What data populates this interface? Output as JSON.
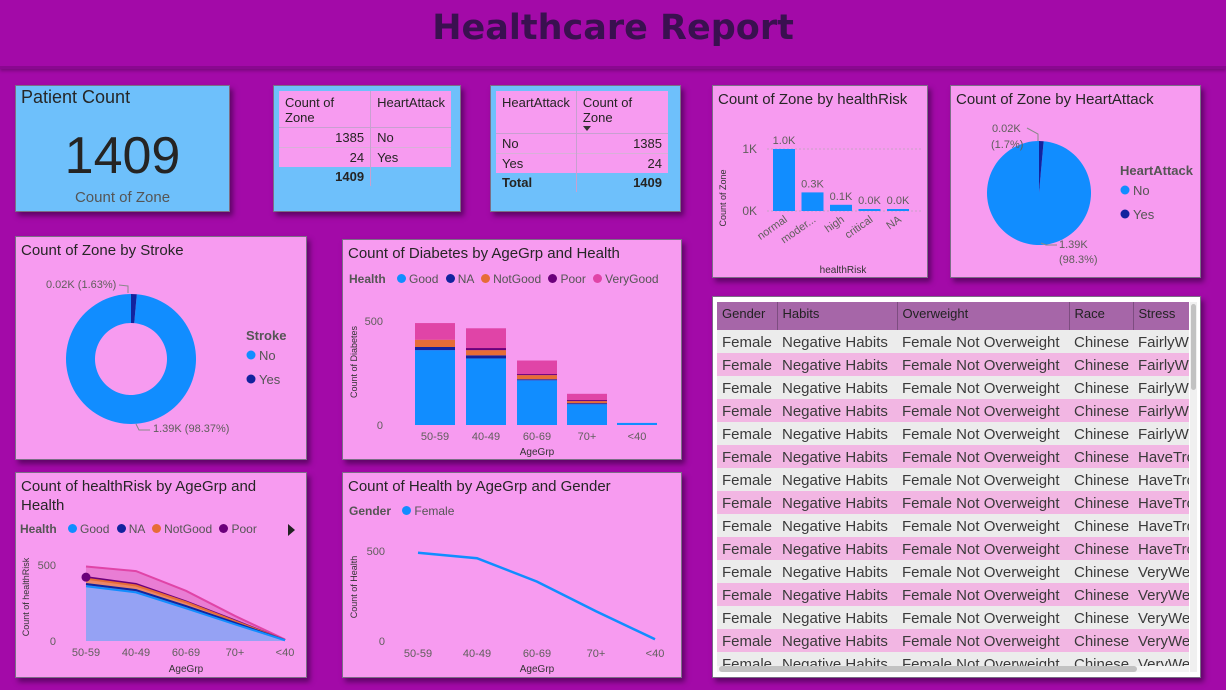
{
  "report_title": "Healthcare Report",
  "kpi": {
    "title": "Patient Count",
    "value": "1409",
    "label": "Count of Zone"
  },
  "matrix1": {
    "headers": [
      "Count of Zone",
      "HeartAttack"
    ],
    "rows": [
      [
        "1385",
        "No"
      ],
      [
        "24",
        "Yes"
      ]
    ],
    "total": "1409"
  },
  "matrix2": {
    "headers": [
      "HeartAttack",
      "Count of Zone"
    ],
    "rows": [
      [
        "No",
        "1385"
      ],
      [
        "Yes",
        "24"
      ]
    ],
    "total_label": "Total",
    "total": "1409"
  },
  "colors": {
    "good": "#118dff",
    "na": "#12239e",
    "notgood": "#e66c37",
    "poor": "#6b007b",
    "verygood": "#e044a7",
    "card_pink": "#f79bf0",
    "card_blue": "#6ec0fb",
    "background": "#a30aa8"
  },
  "icons": {
    "visual_more": "play-triangle-icon"
  },
  "data_table": {
    "columns": [
      "Gender",
      "Habits",
      "Overweight",
      "Race",
      "Stress"
    ],
    "rows": [
      [
        "Female",
        "Negative Habits",
        "Female Not Overweight",
        "Chinese",
        "FairlyW"
      ],
      [
        "Female",
        "Negative Habits",
        "Female Not Overweight",
        "Chinese",
        "FairlyW"
      ],
      [
        "Female",
        "Negative Habits",
        "Female Not Overweight",
        "Chinese",
        "FairlyW"
      ],
      [
        "Female",
        "Negative Habits",
        "Female Not Overweight",
        "Chinese",
        "FairlyW"
      ],
      [
        "Female",
        "Negative Habits",
        "Female Not Overweight",
        "Chinese",
        "FairlyW"
      ],
      [
        "Female",
        "Negative Habits",
        "Female Not Overweight",
        "Chinese",
        "HaveTro"
      ],
      [
        "Female",
        "Negative Habits",
        "Female Not Overweight",
        "Chinese",
        "HaveTro"
      ],
      [
        "Female",
        "Negative Habits",
        "Female Not Overweight",
        "Chinese",
        "HaveTro"
      ],
      [
        "Female",
        "Negative Habits",
        "Female Not Overweight",
        "Chinese",
        "HaveTro"
      ],
      [
        "Female",
        "Negative Habits",
        "Female Not Overweight",
        "Chinese",
        "HaveTro"
      ],
      [
        "Female",
        "Negative Habits",
        "Female Not Overweight",
        "Chinese",
        "VeryWe"
      ],
      [
        "Female",
        "Negative Habits",
        "Female Not Overweight",
        "Chinese",
        "VeryWe"
      ],
      [
        "Female",
        "Negative Habits",
        "Female Not Overweight",
        "Chinese",
        "VeryWe"
      ],
      [
        "Female",
        "Negative Habits",
        "Female Not Overweight",
        "Chinese",
        "VeryWe"
      ],
      [
        "Female",
        "Negative Habits",
        "Female Not Overweight",
        "Chinese",
        "VeryWe"
      ]
    ]
  },
  "chart_data": [
    {
      "id": "zone_by_healthrisk",
      "type": "bar",
      "title": "Count of Zone by healthRisk",
      "xlabel": "healthRisk",
      "ylabel": "Count of Zone",
      "categories": [
        "normal",
        "moder...",
        "high",
        "critical",
        "NA"
      ],
      "values": [
        1000,
        300,
        100,
        0,
        0
      ],
      "data_labels": [
        "1.0K",
        "0.3K",
        "0.1K",
        "0.0K",
        "0.0K"
      ],
      "yticks": [
        "0K",
        "1K"
      ],
      "ylim": [
        0,
        1000
      ],
      "grid": true
    },
    {
      "id": "zone_by_heartattack",
      "type": "pie",
      "title": "Count of Zone by HeartAttack",
      "legend_title": "HeartAttack",
      "categories": [
        "No",
        "Yes"
      ],
      "values": [
        1390,
        20
      ],
      "labels": [
        "1.39K",
        "0.02K"
      ],
      "percents": [
        "(98.3%)",
        "(1.7%)"
      ],
      "legend": "right"
    },
    {
      "id": "zone_by_stroke",
      "type": "pie",
      "donut": true,
      "title": "Count of Zone by Stroke",
      "legend_title": "Stroke",
      "categories": [
        "No",
        "Yes"
      ],
      "values": [
        1390,
        20
      ],
      "labels": [
        "1.39K (98.37%)",
        "0.02K (1.63%)"
      ],
      "legend": "right"
    },
    {
      "id": "diabetes_by_agegrp_health",
      "type": "bar",
      "stacked": true,
      "title": "Count of Diabetes by AgeGrp and Health",
      "legend_title": "Health",
      "xlabel": "AgeGrp",
      "ylabel": "Count of Diabetes",
      "categories": [
        "50-59",
        "40-49",
        "60-69",
        "70+",
        "<40"
      ],
      "series": [
        {
          "name": "Good",
          "values": [
            360,
            320,
            215,
            100,
            10
          ]
        },
        {
          "name": "NA",
          "values": [
            15,
            15,
            5,
            5,
            0
          ]
        },
        {
          "name": "NotGood",
          "values": [
            35,
            25,
            20,
            10,
            0
          ]
        },
        {
          "name": "Poor",
          "values": [
            0,
            10,
            5,
            5,
            0
          ]
        },
        {
          "name": "VeryGood",
          "values": [
            80,
            95,
            65,
            30,
            0
          ]
        }
      ],
      "yticks": [
        0,
        500
      ],
      "ylim": [
        0,
        500
      ],
      "legend": "top"
    },
    {
      "id": "healthrisk_by_agegrp_health",
      "type": "area",
      "title": "Count of healthRisk by AgeGrp and Health",
      "legend_title": "Health",
      "xlabel": "AgeGrp",
      "ylabel": "Count of healthRisk",
      "categories": [
        "50-59",
        "40-49",
        "60-69",
        "70+",
        "<40"
      ],
      "series": [
        {
          "name": "Good",
          "values": [
            360,
            320,
            215,
            110,
            5
          ]
        },
        {
          "name": "NA",
          "values": [
            375,
            335,
            230,
            120,
            5
          ]
        },
        {
          "name": "NotGood",
          "values": [
            410,
            365,
            255,
            130,
            5
          ]
        },
        {
          "name": "Poor",
          "values": [
            420,
            375,
            260,
            135,
            5
          ]
        },
        {
          "name": "VeryGood",
          "values": [
            490,
            460,
            330,
            165,
            10
          ]
        }
      ],
      "yticks": [
        0,
        500
      ],
      "ylim": [
        0,
        500
      ],
      "legend": "top"
    },
    {
      "id": "health_by_agegrp_gender",
      "type": "line",
      "title": "Count of Health by AgeGrp and Gender",
      "legend_title": "Gender",
      "xlabel": "AgeGrp",
      "ylabel": "Count of Health",
      "categories": [
        "50-59",
        "40-49",
        "60-69",
        "70+",
        "<40"
      ],
      "series": [
        {
          "name": "Female",
          "values": [
            490,
            460,
            330,
            165,
            10
          ]
        }
      ],
      "yticks": [
        0,
        500
      ],
      "ylim": [
        0,
        500
      ],
      "legend": "top"
    }
  ]
}
